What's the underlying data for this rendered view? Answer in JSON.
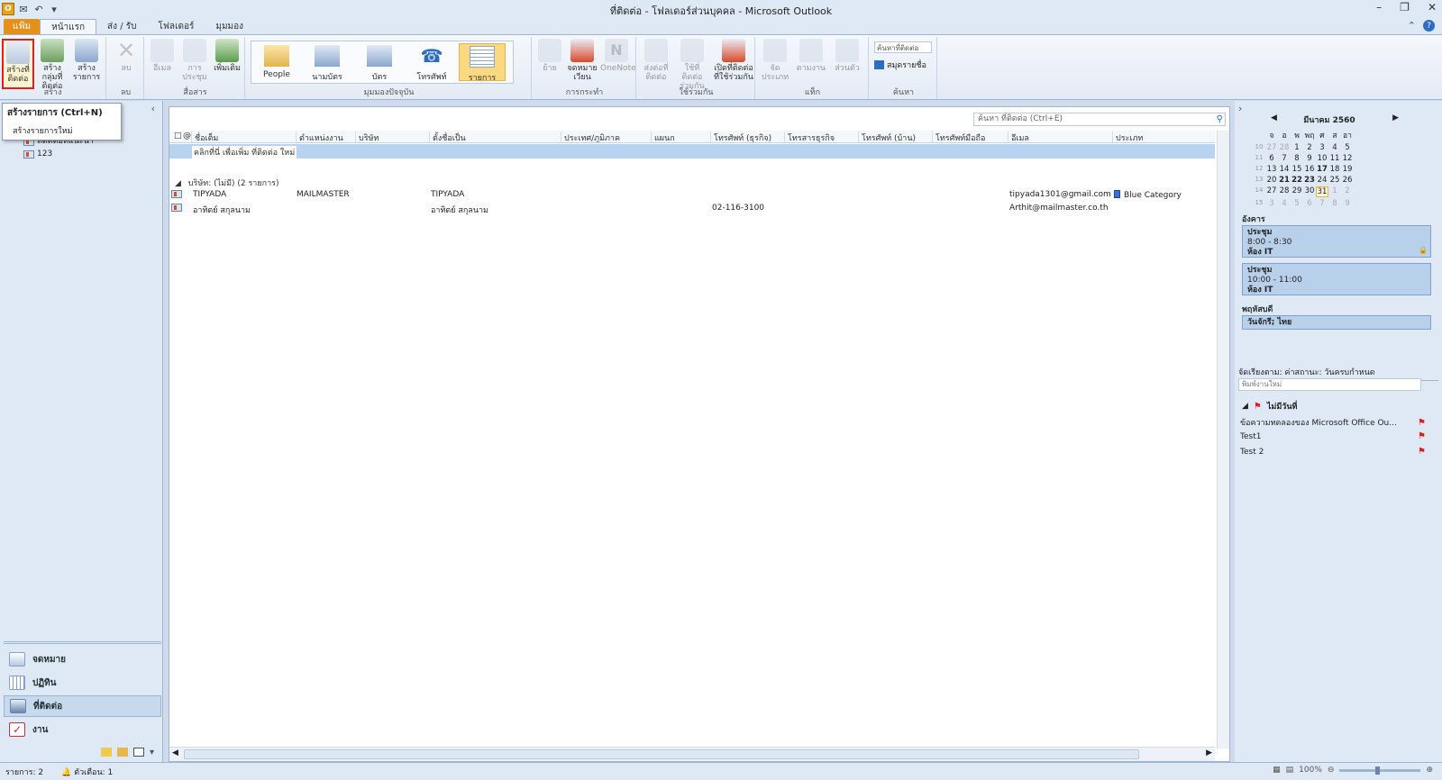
{
  "title": "ที่ติดต่อ - โฟลเดอร์ส่วนบุคคล - Microsoft Outlook",
  "tabs": [
    {
      "label": "แฟ้ม"
    },
    {
      "label": "หน้าแรก"
    },
    {
      "label": "ส่ง / รับ"
    },
    {
      "label": "โฟลเดอร์"
    },
    {
      "label": "มุมมอง"
    }
  ],
  "ribbon": {
    "new_group": {
      "label": "สร้าง",
      "new_contact": "สร้างที่ติดต่อ",
      "new_group": "สร้างกลุ่มที่ติดต่อ",
      "new_items": "สร้างรายการ"
    },
    "delete_group": {
      "label": "ลบ",
      "delete": "ลบ"
    },
    "comm_group": {
      "label": "สื่อสาร",
      "email": "อีเมล",
      "meeting": "การประชุม",
      "more": "เพิ่มเติม"
    },
    "view_group": {
      "label": "มุมมองปัจจุบัน",
      "people": "People",
      "business_card": "นามบัตร",
      "card": "บัตร",
      "phone": "โทรศัพท์",
      "list": "รายการ"
    },
    "actions_group": {
      "label": "การกระทำ",
      "move": "ย้าย",
      "mail_merge": "จดหมายเวียน",
      "onenote": "OneNote"
    },
    "share_group": {
      "label": "ใช้ร่วมกัน",
      "forward": "ส่งต่อที่ติดต่อ",
      "share": "ใช้ที่ติดต่อร่วมกัน",
      "open_shared": "เปิดที่ติดต่อที่ใช้ร่วมกัน"
    },
    "tags_group": {
      "label": "แท็ก",
      "categorize": "จัดประเภท",
      "follow_up": "ตามงาน",
      "private": "ส่วนตัว"
    },
    "find_group": {
      "label": "ค้นหา",
      "search_people": "ค้นหาที่ติดต่อ",
      "address_book": "สมุดรายชื่อ"
    }
  },
  "tooltip": {
    "title": "สร้างรายการ (Ctrl+N)",
    "desc": "สร้างรายการใหม่"
  },
  "tree": [
    {
      "label": "ที่ติดต่อที่แนะนำ"
    },
    {
      "label": "123"
    }
  ],
  "nav": [
    {
      "label": "จดหมาย"
    },
    {
      "label": "ปฏิทิน"
    },
    {
      "label": "ที่ติดต่อ"
    },
    {
      "label": "งาน"
    }
  ],
  "main": {
    "search_placeholder": "ค้นหา ที่ติดต่อ (Ctrl+E)",
    "columns": [
      "ชื่อเต็ม",
      "ตำแหน่งงาน",
      "บริษัท",
      "ตั้งชื่อเป็น",
      "ประเทศ/ภูมิภาค",
      "แผนก",
      "โทรศัพท์ (ธุรกิจ)",
      "โทรสารธุรกิจ",
      "โทรศัพท์ (บ้าน)",
      "โทรศัพท์มือถือ",
      "อีเมล",
      "ประเภท"
    ],
    "new_row_text": "คลิกที่นี่ เพื่อเพิ่ม ที่ติดต่อ ใหม่",
    "group_header": "บริษัท: (ไม่มี) (2 รายการ)",
    "rows": [
      {
        "full_name": "TIPYADA",
        "job_title": "MAILMASTER",
        "company": "",
        "file_as": "TIPYADA",
        "country": "",
        "department": "",
        "business_phone": "",
        "business_fax": "",
        "home_phone": "",
        "mobile_phone": "",
        "email": "tipyada1301@gmail.com",
        "category": "Blue Category"
      },
      {
        "full_name": "อาทิตย์ สกุลนาม",
        "job_title": "",
        "company": "",
        "file_as": "อาทิตย์ สกุลนาม",
        "country": "",
        "department": "",
        "business_phone": "02-116-3100",
        "business_fax": "",
        "home_phone": "",
        "mobile_phone": "",
        "email": "Arthit@mailmaster.co.th",
        "category": ""
      }
    ]
  },
  "todo": {
    "month_title": "มีนาคม 2560",
    "weekdays": [
      "จ",
      "อ",
      "พ",
      "พฤ",
      "ศ",
      "ส",
      "อา"
    ],
    "weeks": [
      {
        "wk": "10",
        "days": [
          "27",
          "28",
          "1",
          "2",
          "3",
          "4",
          "5"
        ]
      },
      {
        "wk": "11",
        "days": [
          "6",
          "7",
          "8",
          "9",
          "10",
          "11",
          "12"
        ]
      },
      {
        "wk": "12",
        "days": [
          "13",
          "14",
          "15",
          "16",
          "17",
          "18",
          "19"
        ]
      },
      {
        "wk": "13",
        "days": [
          "20",
          "21",
          "22",
          "23",
          "24",
          "25",
          "26"
        ]
      },
      {
        "wk": "14",
        "days": [
          "27",
          "28",
          "29",
          "30",
          "31",
          "1",
          "2"
        ]
      },
      {
        "wk": "15",
        "days": [
          "3",
          "4",
          "5",
          "6",
          "7",
          "8",
          "9"
        ]
      }
    ],
    "today": "31",
    "day1": "อังคาร",
    "appointments": [
      {
        "title": "ประชุม",
        "time": "8:00 - 8:30",
        "location": "ห้อง IT"
      },
      {
        "title": "ประชุม",
        "time": "10:00 - 11:00",
        "location": "ห้อง IT"
      }
    ],
    "day2": "พฤหัสบดี",
    "allday_event": "วันจักรี; ไทย",
    "tasks_header": "จัดเรียงตาม: ค่าสถานะ: วันครบกำหนด",
    "new_task_placeholder": "พิมพ์งานใหม่",
    "no_date": "ไม่มีวันที่",
    "tasks": [
      {
        "label": "ข้อความทดลองของ Microsoft Office Ou..."
      },
      {
        "label": "Test1"
      },
      {
        "label": "Test 2"
      }
    ]
  },
  "status": {
    "items": "รายการ: 2",
    "reminders": "ตัวเตือน: 1",
    "zoom": "100%"
  }
}
